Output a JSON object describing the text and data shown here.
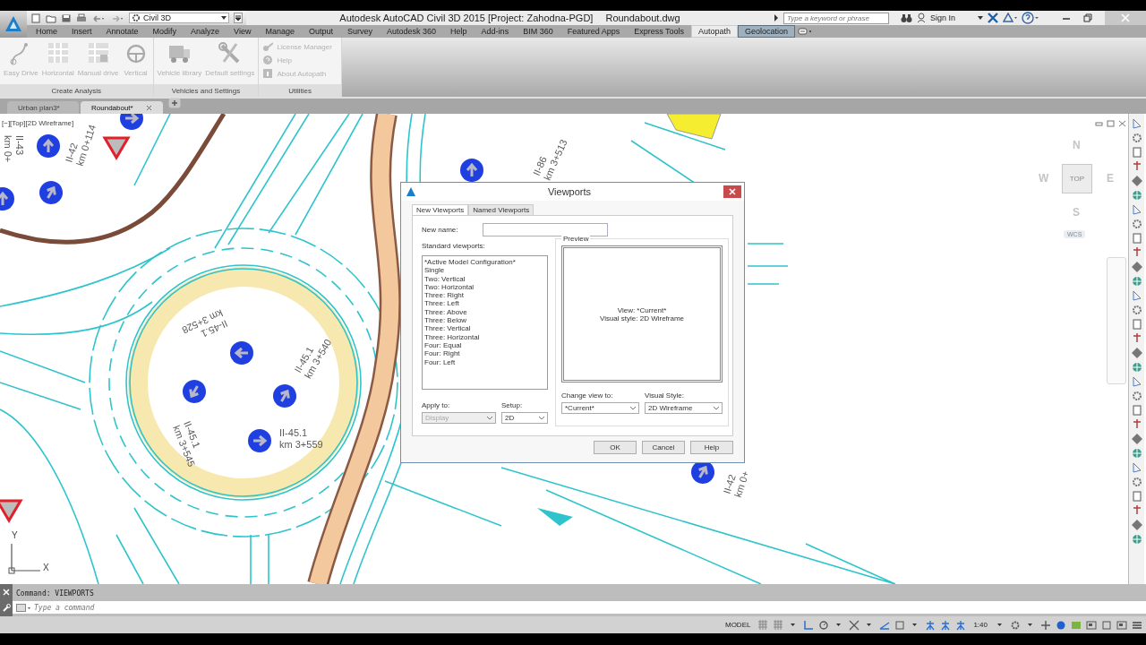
{
  "title_bar": {
    "workspace": "Civil 3D",
    "title": "Autodesk AutoCAD Civil 3D 2015 [Project: Zahodna-PGD]",
    "file": "Roundabout.dwg",
    "search_placeholder": "Type a keyword or phrase",
    "sign_in": "Sign In"
  },
  "ribbon_tabs": [
    {
      "label": "Home",
      "selected": false,
      "kind": "normal"
    },
    {
      "label": "Insert",
      "selected": false,
      "kind": "normal"
    },
    {
      "label": "Annotate",
      "selected": false,
      "kind": "normal"
    },
    {
      "label": "Modify",
      "selected": false,
      "kind": "normal"
    },
    {
      "label": "Analyze",
      "selected": false,
      "kind": "normal"
    },
    {
      "label": "View",
      "selected": false,
      "kind": "normal"
    },
    {
      "label": "Manage",
      "selected": false,
      "kind": "normal"
    },
    {
      "label": "Output",
      "selected": false,
      "kind": "normal"
    },
    {
      "label": "Survey",
      "selected": false,
      "kind": "normal"
    },
    {
      "label": "Autodesk 360",
      "selected": false,
      "kind": "normal"
    },
    {
      "label": "Help",
      "selected": false,
      "kind": "normal"
    },
    {
      "label": "Add-ins",
      "selected": false,
      "kind": "normal"
    },
    {
      "label": "BIM 360",
      "selected": false,
      "kind": "normal"
    },
    {
      "label": "Featured Apps",
      "selected": false,
      "kind": "normal"
    },
    {
      "label": "Express Tools",
      "selected": false,
      "kind": "normal"
    },
    {
      "label": "Autopath",
      "selected": true,
      "kind": "normal"
    },
    {
      "label": "Geolocation",
      "selected": false,
      "kind": "contextual"
    }
  ],
  "ribbon_panels": [
    {
      "title": "Create Analysis",
      "kind": "large",
      "tools": [
        {
          "label": "Easy Drive",
          "disabled": true
        },
        {
          "label": "Horizontal",
          "disabled": true
        },
        {
          "label": "Manual drive",
          "disabled": true
        },
        {
          "label": "Vertical",
          "disabled": true
        }
      ]
    },
    {
      "title": "Vehicles and Settings",
      "kind": "large",
      "tools": [
        {
          "label": "Vehicle library",
          "disabled": true
        },
        {
          "label": "Default settings",
          "disabled": true
        }
      ]
    },
    {
      "title": "Utilities",
      "kind": "small",
      "tools": [
        {
          "label": "License Manager",
          "disabled": true
        },
        {
          "label": "Help",
          "disabled": true
        },
        {
          "label": "About Autopath",
          "disabled": true
        }
      ]
    }
  ],
  "doc_tabs": [
    {
      "label": "Urban plan3*",
      "selected": false
    },
    {
      "label": "Roundabout*",
      "selected": true
    }
  ],
  "viewport_label": "[−][Top][2D Wireframe]",
  "drawing_labels": [
    {
      "lines": [
        "II-45.1",
        "km 3+559"
      ]
    },
    {
      "lines": [
        "II-45.1",
        "km 3+540"
      ]
    },
    {
      "lines": [
        "II-45.1",
        "km 3+528"
      ]
    },
    {
      "lines": [
        "II-45.1",
        "km 3+545"
      ]
    },
    {
      "lines": [
        "II-42",
        "km 0+114"
      ]
    },
    {
      "lines": [
        "II-43",
        "km 0+"
      ]
    },
    {
      "lines": [
        "II-86",
        "km 3+513"
      ]
    },
    {
      "lines": [
        "II-42",
        "km 0+"
      ]
    }
  ],
  "axes": {
    "y": "Y",
    "x": "X"
  },
  "view_cube": {
    "north": "N",
    "west": "W",
    "east": "E",
    "south": "S",
    "face": "TOP",
    "ucs": "WCS"
  },
  "dialog": {
    "title": "Viewports",
    "tabs": [
      {
        "label": "New Viewports",
        "selected": true
      },
      {
        "label": "Named Viewports",
        "selected": false
      }
    ],
    "new_name_label": "New name:",
    "standard_label": "Standard viewports:",
    "viewports": [
      {
        "label": "*Active Model Configuration*",
        "selected": false
      },
      {
        "label": "Single",
        "selected": false
      },
      {
        "label": "Two: Vertical",
        "selected": false
      },
      {
        "label": "Two: Horizontal",
        "selected": false
      },
      {
        "label": "Three: Right",
        "selected": false
      },
      {
        "label": "Three: Left",
        "selected": false
      },
      {
        "label": "Three: Above",
        "selected": false
      },
      {
        "label": "Three: Below",
        "selected": false
      },
      {
        "label": "Three: Vertical",
        "selected": false
      },
      {
        "label": "Three: Horizontal",
        "selected": false
      },
      {
        "label": "Four: Equal",
        "selected": false
      },
      {
        "label": "Four: Right",
        "selected": false
      },
      {
        "label": "Four: Left",
        "selected": false
      }
    ],
    "preview_label": "Preview",
    "preview_lines": [
      "View: *Current*",
      "Visual style: 2D Wireframe"
    ],
    "dropdowns": [
      {
        "label": "Apply to:",
        "value": "Display",
        "disabled": true
      },
      {
        "label": "Setup:",
        "value": "2D",
        "disabled": false
      },
      {
        "label": "Change view to:",
        "value": "*Current*",
        "disabled": false
      },
      {
        "label": "Visual Style:",
        "value": "2D Wireframe",
        "disabled": false
      }
    ],
    "buttons": [
      "OK",
      "Cancel",
      "Help"
    ]
  },
  "command": {
    "history": "Command: VIEWPORTS",
    "placeholder": "Type a command"
  },
  "status_bar": {
    "space": "MODEL",
    "scale": "1:40"
  }
}
